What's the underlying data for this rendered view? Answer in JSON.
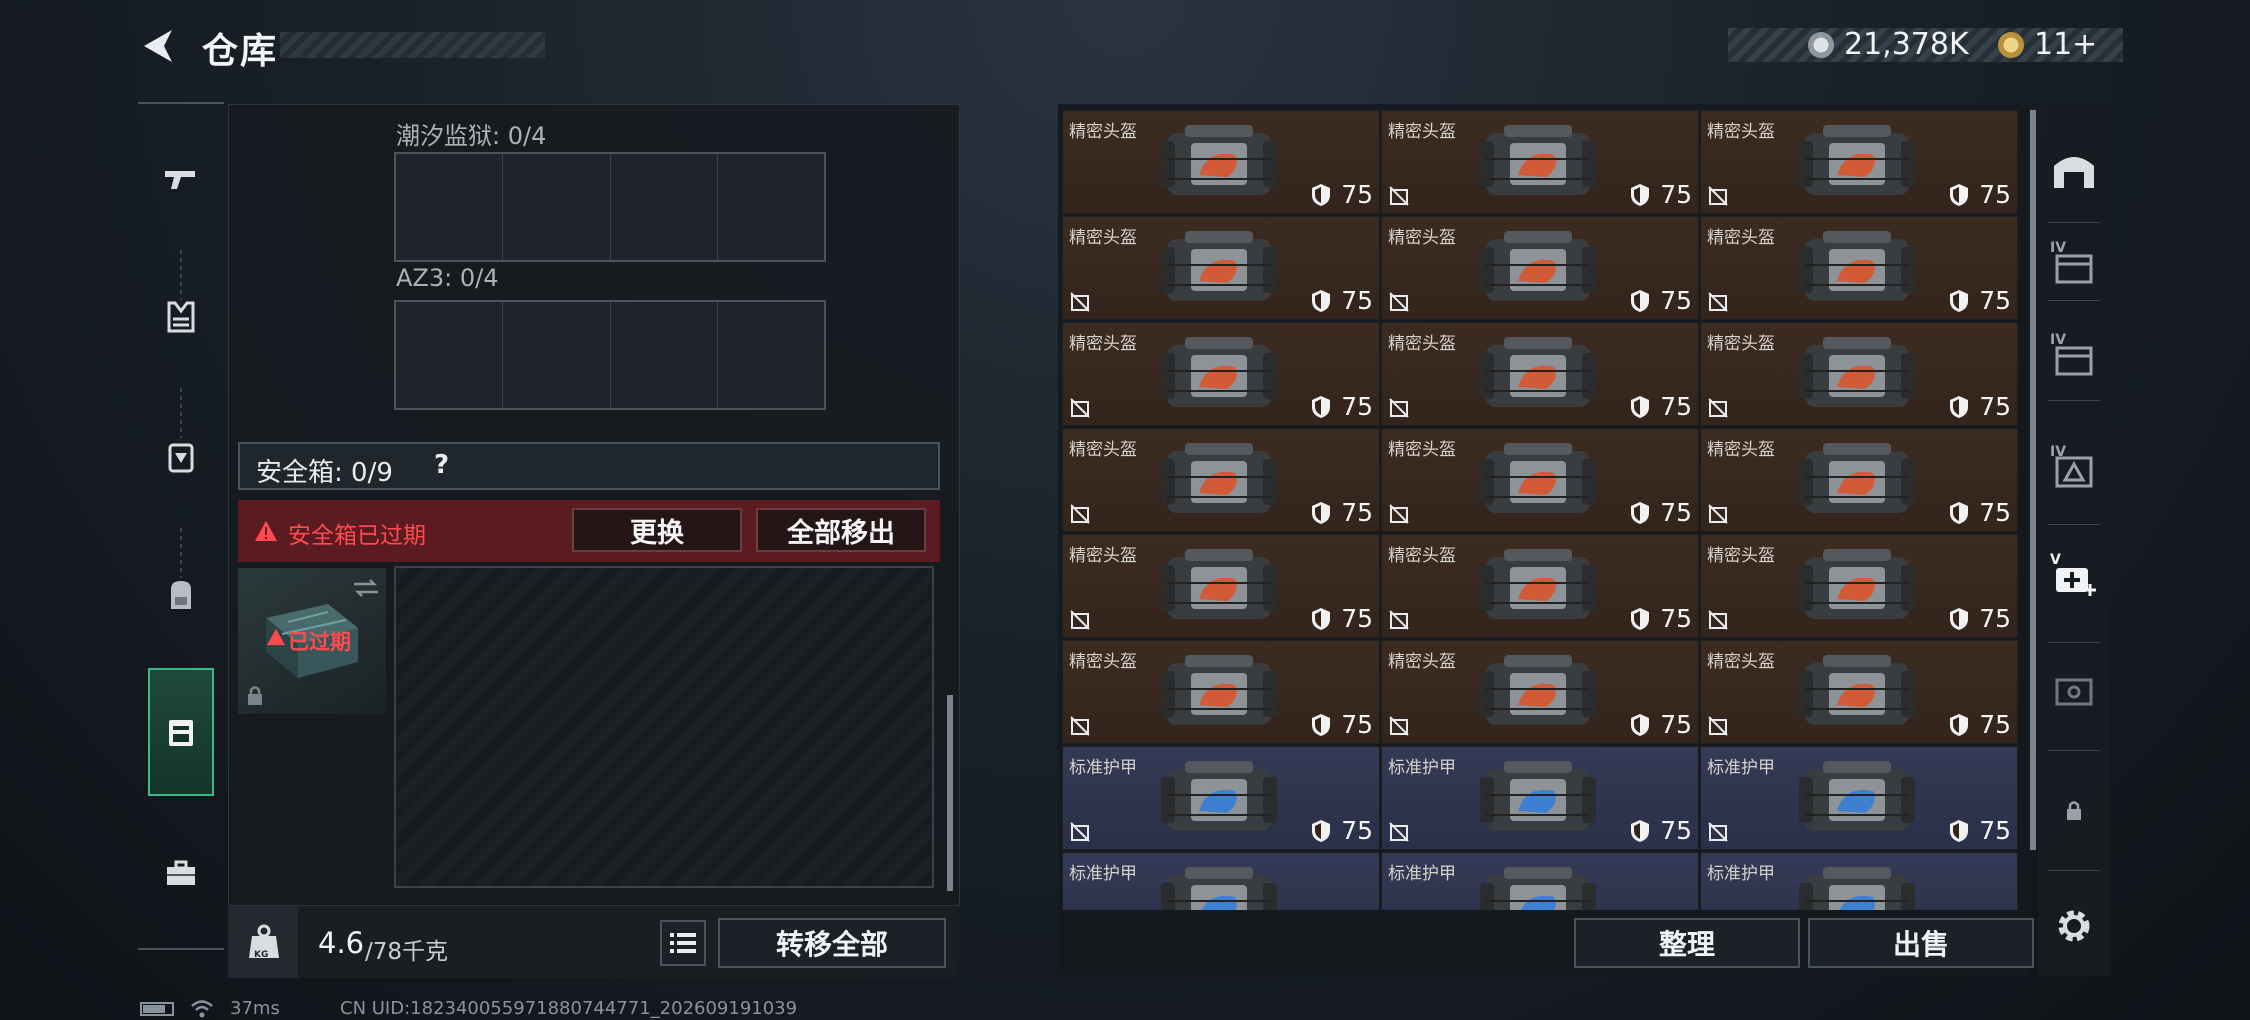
{
  "header": {
    "title": "仓库",
    "currency_1": "21,378K",
    "currency_2": "11+"
  },
  "left_panel": {
    "slot_a_label": "潮汐监狱: 0/4",
    "slot_b_label": "AZ3: 0/4",
    "safe_box_label": "安全箱: 0/9",
    "help_mark": "?",
    "expired_warning": "安全箱已过期",
    "replace_button": "更换",
    "move_all_out_button": "全部移出",
    "case_expired_tag": "已过期",
    "weight_value": "4.6",
    "weight_max": "/78千克",
    "weight_icon_text": "KG",
    "transfer_all_button": "转移全部"
  },
  "right_panel": {
    "items": [
      {
        "name": "精密头盔",
        "durability": "75",
        "kind": "helmet",
        "broken": false
      },
      {
        "name": "精密头盔",
        "durability": "75",
        "kind": "helmet",
        "broken": true
      },
      {
        "name": "精密头盔",
        "durability": "75",
        "kind": "helmet",
        "broken": true
      },
      {
        "name": "精密头盔",
        "durability": "75",
        "kind": "helmet",
        "broken": true
      },
      {
        "name": "精密头盔",
        "durability": "75",
        "kind": "helmet",
        "broken": true
      },
      {
        "name": "精密头盔",
        "durability": "75",
        "kind": "helmet",
        "broken": true
      },
      {
        "name": "精密头盔",
        "durability": "75",
        "kind": "helmet",
        "broken": true
      },
      {
        "name": "精密头盔",
        "durability": "75",
        "kind": "helmet",
        "broken": true
      },
      {
        "name": "精密头盔",
        "durability": "75",
        "kind": "helmet",
        "broken": true
      },
      {
        "name": "精密头盔",
        "durability": "75",
        "kind": "helmet",
        "broken": true
      },
      {
        "name": "精密头盔",
        "durability": "75",
        "kind": "helmet",
        "broken": true
      },
      {
        "name": "精密头盔",
        "durability": "75",
        "kind": "helmet",
        "broken": true
      },
      {
        "name": "精密头盔",
        "durability": "75",
        "kind": "helmet",
        "broken": true
      },
      {
        "name": "精密头盔",
        "durability": "75",
        "kind": "helmet",
        "broken": true
      },
      {
        "name": "精密头盔",
        "durability": "75",
        "kind": "helmet",
        "broken": true
      },
      {
        "name": "精密头盔",
        "durability": "75",
        "kind": "helmet",
        "broken": true
      },
      {
        "name": "精密头盔",
        "durability": "75",
        "kind": "helmet",
        "broken": true
      },
      {
        "name": "精密头盔",
        "durability": "75",
        "kind": "helmet",
        "broken": true
      },
      {
        "name": "标准护甲",
        "durability": "75",
        "kind": "armor",
        "broken": true
      },
      {
        "name": "标准护甲",
        "durability": "75",
        "kind": "armor",
        "broken": true
      },
      {
        "name": "标准护甲",
        "durability": "75",
        "kind": "armor",
        "broken": true
      },
      {
        "name": "标准护甲",
        "durability": "",
        "kind": "armor",
        "broken": false
      },
      {
        "name": "标准护甲",
        "durability": "",
        "kind": "armor",
        "broken": false
      },
      {
        "name": "标准护甲",
        "durability": "",
        "kind": "armor",
        "broken": false
      }
    ],
    "sort_button": "整理",
    "sell_button": "出售"
  },
  "right_nav": {
    "tier_labels": [
      "IV",
      "IV",
      "IV",
      "V"
    ]
  },
  "footer": {
    "ping": "37ms",
    "uid": "CN UID:18234005597188074477​1_202609191039"
  },
  "colors": {
    "accent_green": "#3fb988",
    "expired_red": "#e0393e",
    "helmet_cell": "#3c2b21",
    "armor_cell": "#343a55"
  },
  "icons": {
    "back": "back-arrow-icon",
    "weapon": "pistol-icon",
    "vest": "vest-icon",
    "helmet": "helmet-icon",
    "backpack": "backpack-icon",
    "safe_case": "case-icon",
    "toolbox": "briefcase-icon",
    "settings": "gear-icon"
  }
}
